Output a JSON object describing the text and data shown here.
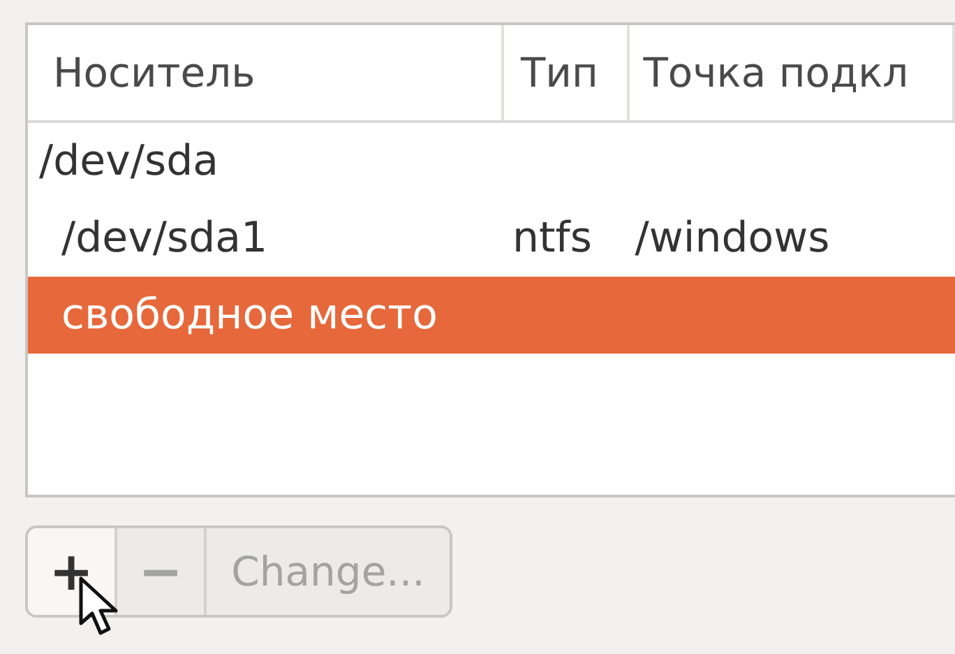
{
  "table": {
    "columns": [
      "Носитель",
      "Тип",
      "Точка подкл"
    ],
    "rows": [
      {
        "device": "/dev/sda",
        "selected": false,
        "children": [
          {
            "device": "/dev/sda1",
            "type": "ntfs",
            "mount": "/windows",
            "selected": false
          },
          {
            "device": "свободное место",
            "selected": true
          }
        ]
      }
    ]
  },
  "buttons": [
    {
      "kind": "icon",
      "label": "+",
      "disabled": false
    },
    {
      "kind": "icon",
      "label": "−",
      "disabled": true
    },
    {
      "kind": "text",
      "label": "Change...",
      "disabled": true
    }
  ]
}
